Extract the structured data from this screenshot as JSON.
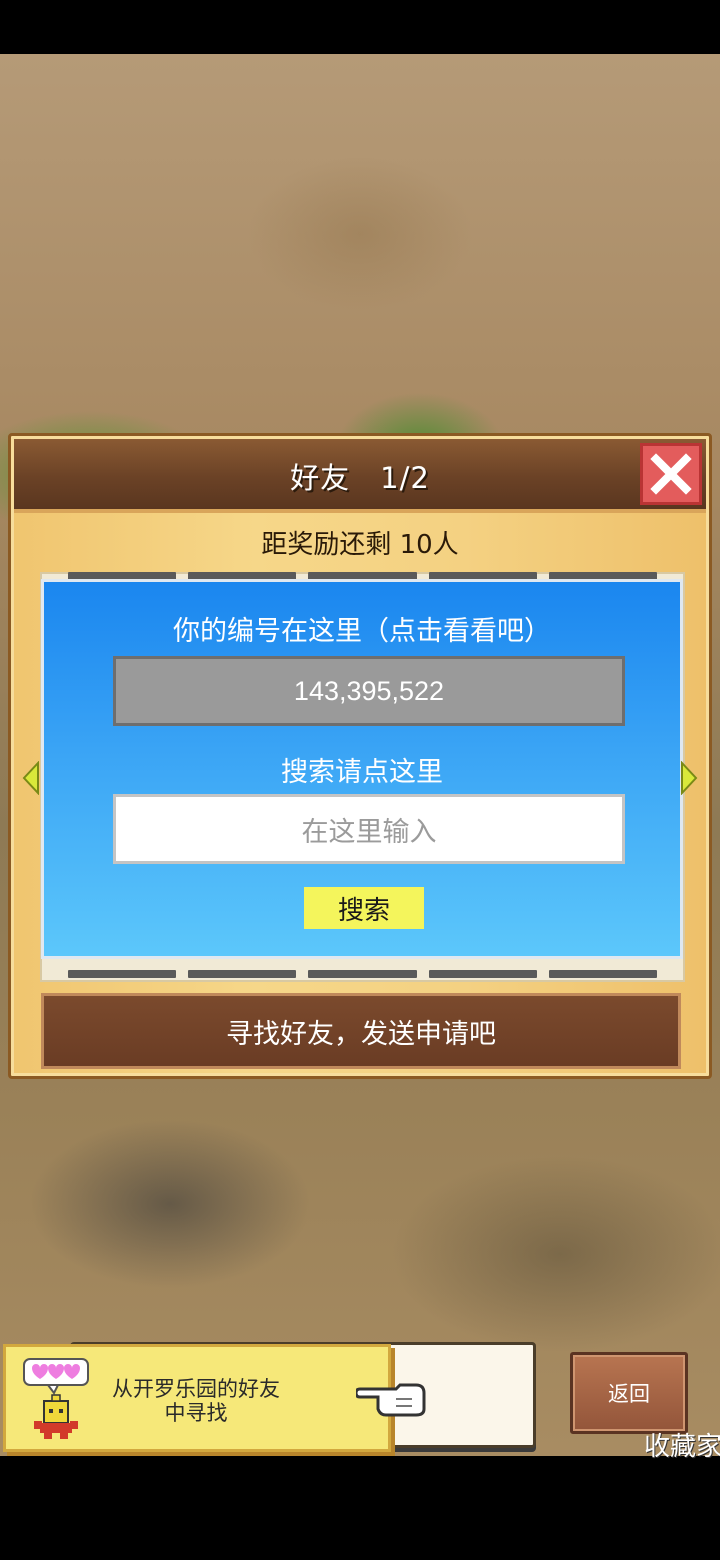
{
  "dialog": {
    "title": "好友　1/2",
    "reward_text": "距奖励还剩 10人",
    "id_caption": "你的编号在这里（点击看看吧）",
    "player_id": "143,395,522",
    "search_caption": "搜索请点这里",
    "search_placeholder": "在这里输入",
    "search_button": "搜索",
    "find_friends_button": "寻找好友，发送申请吧",
    "close_icon": "close-icon",
    "prev_icon": "arrow-left-icon",
    "next_icon": "arrow-right-icon"
  },
  "bottom": {
    "friend_hint": "从开罗乐园的好友中寻找",
    "back_button": "返回",
    "collection_label": "收藏家"
  },
  "colors": {
    "accent_yellow": "#f4f55c",
    "panel_blue": "#1a86ef",
    "close_red": "#e35c5c",
    "wood_brown": "#6b4226"
  }
}
